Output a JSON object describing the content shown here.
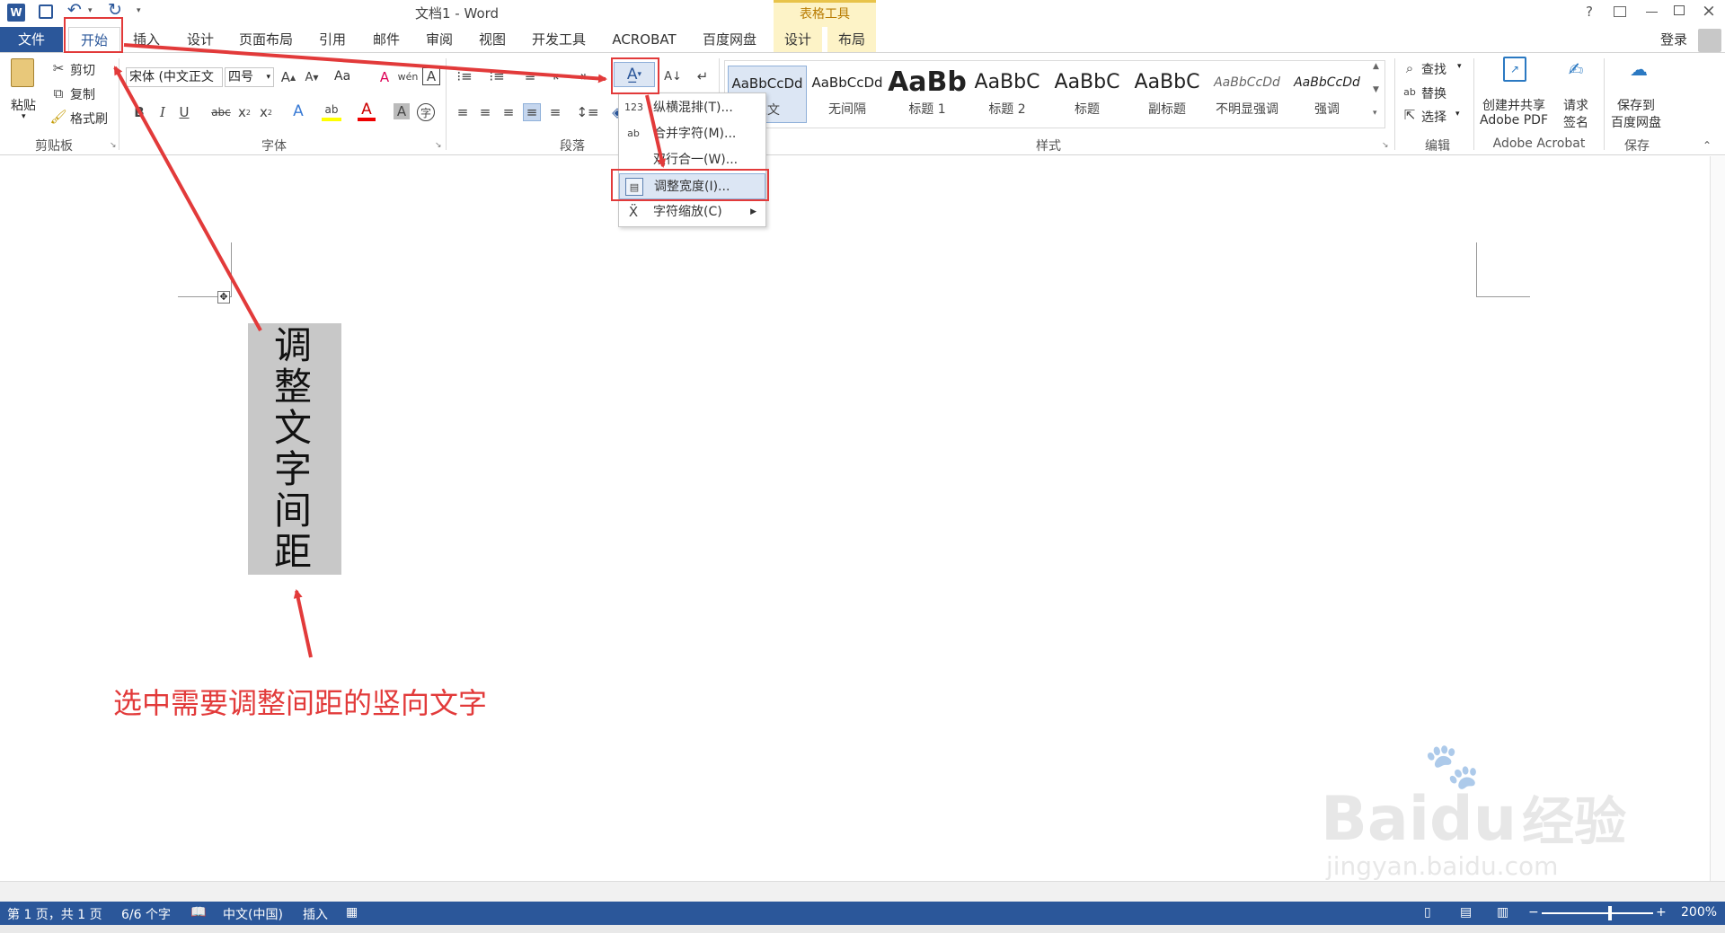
{
  "window": {
    "title": "文档1 - Word",
    "contextual_group": "表格工具",
    "help": "?",
    "signin": "登录"
  },
  "tabs": [
    {
      "label": "文件"
    },
    {
      "label": "开始"
    },
    {
      "label": "插入"
    },
    {
      "label": "设计"
    },
    {
      "label": "页面布局"
    },
    {
      "label": "引用"
    },
    {
      "label": "邮件"
    },
    {
      "label": "审阅"
    },
    {
      "label": "视图"
    },
    {
      "label": "开发工具"
    },
    {
      "label": "ACROBAT"
    },
    {
      "label": "百度网盘"
    },
    {
      "label": "设计"
    },
    {
      "label": "布局"
    }
  ],
  "clipboard": {
    "paste": "粘贴",
    "cut": "剪切",
    "copy": "复制",
    "format_painter": "格式刷",
    "group": "剪贴板"
  },
  "font": {
    "name": "宋体 (中文正文",
    "size": "四号",
    "case_button": "Aa",
    "group": "字体"
  },
  "paragraph": {
    "group": "段落"
  },
  "styles": {
    "items": [
      {
        "sample": "AaBbCcDd",
        "name": "正文"
      },
      {
        "sample": "AaBbCcDd",
        "name": "无间隔"
      },
      {
        "sample": "AaBb",
        "name": "标题 1"
      },
      {
        "sample": "AaBbC",
        "name": "标题 2"
      },
      {
        "sample": "AaBbC",
        "name": "标题"
      },
      {
        "sample": "AaBbC",
        "name": "副标题"
      },
      {
        "sample": "AaBbCcDd",
        "name": "不明显强调"
      },
      {
        "sample": "AaBbCcDd",
        "name": "强调"
      }
    ],
    "group": "样式"
  },
  "editing": {
    "find": "查找",
    "replace": "替换",
    "select": "选择",
    "group": "编辑"
  },
  "acrobat": {
    "create_share": "创建并共享",
    "adobe_pdf": "Adobe PDF",
    "request": "请求",
    "sign": "签名",
    "group": "Adobe Acrobat"
  },
  "save": {
    "line1": "保存到",
    "line2": "百度网盘",
    "group": "保存"
  },
  "dropdown": {
    "items": [
      {
        "icon": "123",
        "label": "纵横混排(T)..."
      },
      {
        "icon": "ab",
        "label": "合并字符(M)..."
      },
      {
        "icon": "",
        "label": "双行合一(W)..."
      },
      {
        "icon": "",
        "label": "调整宽度(I)..."
      },
      {
        "icon": "",
        "label": "字符缩放(C)"
      }
    ]
  },
  "document": {
    "vertical_text": [
      "调",
      "整",
      "文",
      "字",
      "间",
      "距"
    ],
    "annotation": "选中需要调整间距的竖向文字"
  },
  "status": {
    "page": "第 1 页，共 1 页",
    "words": "6/6 个字",
    "language": "中文(中国)",
    "mode": "插入",
    "zoom": "200%"
  },
  "watermark": {
    "brand": "Bai",
    "brand2": "du",
    "cn": "经验",
    "url": "jingyan.baidu.com"
  },
  "colors": {
    "accent": "#2b579a",
    "red_annotation": "#e23a3a",
    "contextual_tab_bg": "#fdf3c7",
    "contextual_tab_text": "#b87b00"
  }
}
